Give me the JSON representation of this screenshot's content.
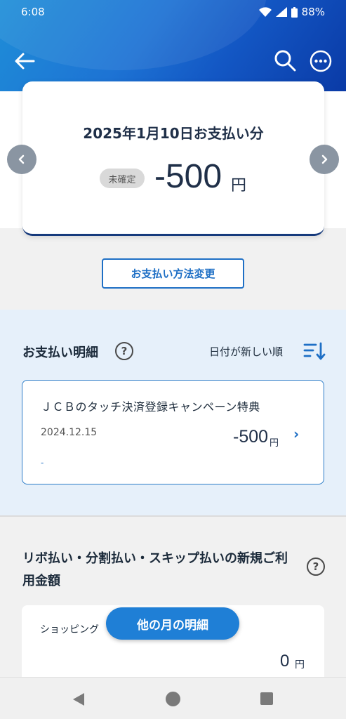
{
  "status_bar": {
    "time": "6:08",
    "battery": "88%"
  },
  "header": {
    "back_icon": "arrow-left-icon",
    "search_icon": "search-icon",
    "more_icon": "more-horizontal-icon"
  },
  "payment_card": {
    "title": "2025年1月10日お支払い分",
    "status_badge": "未確定",
    "amount": "-500",
    "unit": "円"
  },
  "payment_method_button": "お支払い方法変更",
  "details": {
    "title": "お支払い明細",
    "sort_label": "日付が新しい順",
    "items": [
      {
        "name": "ＪＣＢのタッチ決済登録キャンペーン特典",
        "date": "2024.12.15",
        "amount": "-500",
        "unit": "円",
        "note": "-"
      }
    ]
  },
  "revo": {
    "title": "リボ払い・分割払い・スキップ払いの新規ご利用金額",
    "shopping_label": "ショッピング",
    "shopping_amount": "0",
    "unit": "円"
  },
  "other_month_button": "他の月の明細",
  "colors": {
    "accent": "#1f7fd6",
    "header_dark": "#0a3aa6",
    "details_bg": "#e6f0fa"
  }
}
